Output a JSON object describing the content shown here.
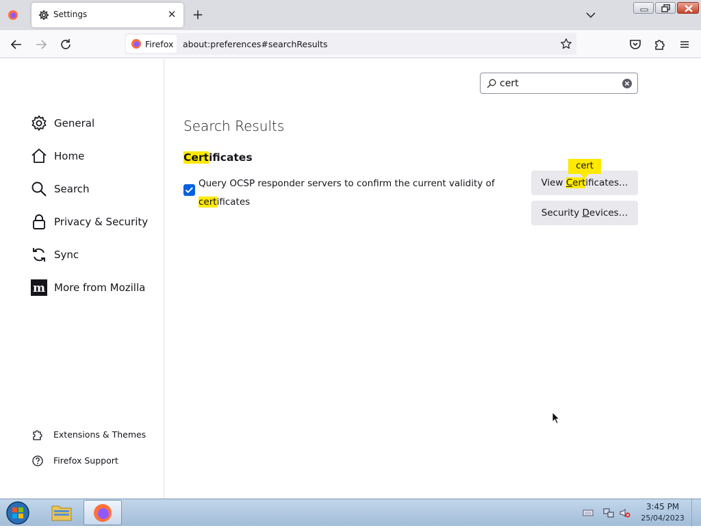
{
  "tab": {
    "title": "Settings"
  },
  "navbar": {
    "identity_label": "Firefox",
    "url": "about:preferences#searchResults"
  },
  "sidebar": {
    "categories": [
      {
        "label": "General",
        "icon": "gear-icon"
      },
      {
        "label": "Home",
        "icon": "home-icon"
      },
      {
        "label": "Search",
        "icon": "magnifier-icon"
      },
      {
        "label": "Privacy & Security",
        "icon": "lock-icon"
      },
      {
        "label": "Sync",
        "icon": "sync-icon"
      },
      {
        "label": "More from Mozilla",
        "icon": "mozilla-m-icon"
      }
    ],
    "footer": [
      {
        "label": "Extensions & Themes",
        "icon": "puzzle-icon"
      },
      {
        "label": "Firefox Support",
        "icon": "help-icon"
      }
    ]
  },
  "search": {
    "value": "cert"
  },
  "results": {
    "title": "Search Results",
    "group_title_match": "Cert",
    "group_title_rest": "ificates",
    "ocsp_label_lead": "Query OCSP responder servers to confirm the current validity of",
    "ocsp_label_match": "cert",
    "ocsp_label_rest": "ificates",
    "ocsp_checked": true,
    "view_certs_pre": "View ",
    "view_certs_access": "C",
    "view_certs_match_rest": "ert",
    "view_certs_post": "ificates…",
    "security_devices_pre": "Security ",
    "security_devices_access": "D",
    "security_devices_post": "evices…",
    "tooltip": "cert"
  },
  "taskbar": {
    "time": "3:45 PM",
    "date": "25/04/2023"
  },
  "colors": {
    "highlight": "#ffe900",
    "accent": "#0061e0",
    "button_bg": "#e9e9ed"
  }
}
